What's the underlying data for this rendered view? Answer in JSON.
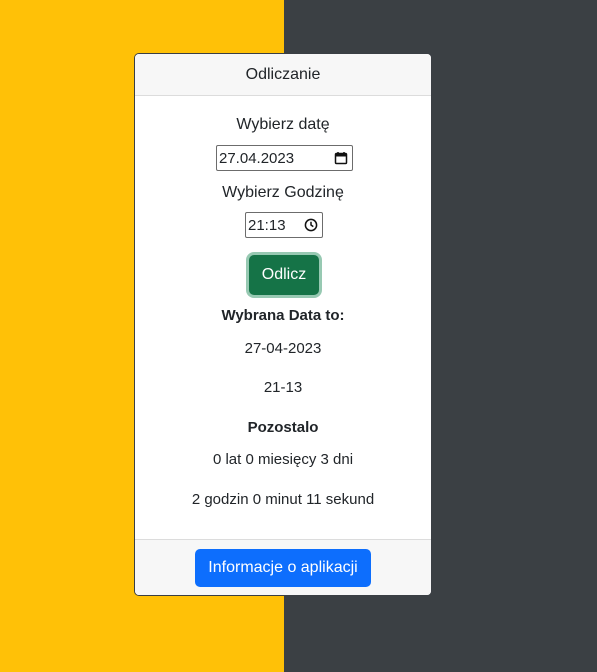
{
  "colors": {
    "left_background": "#ffc107",
    "right_background": "#3b4044",
    "primary_button": "#0d6efd",
    "success_button": "#157347"
  },
  "card": {
    "header_title": "Odliczanie",
    "date_label": "Wybierz datę",
    "date_value": "27.04.2023",
    "date_icon": "calendar-icon",
    "time_label": "Wybierz Godzinę",
    "time_value": "21:13",
    "time_icon": "clock-icon",
    "count_button_label": "Odlicz",
    "selected_heading": "Wybrana Data to:",
    "selected_date": "27-04-2023",
    "selected_time": "21-13",
    "remaining_heading": "Pozostalo",
    "remaining_ymd": "0 lat 0 miesięcy 3 dni",
    "remaining_hms": "2 godzin 0 minut 11 sekund",
    "info_button_label": "Informacje o aplikacji"
  }
}
